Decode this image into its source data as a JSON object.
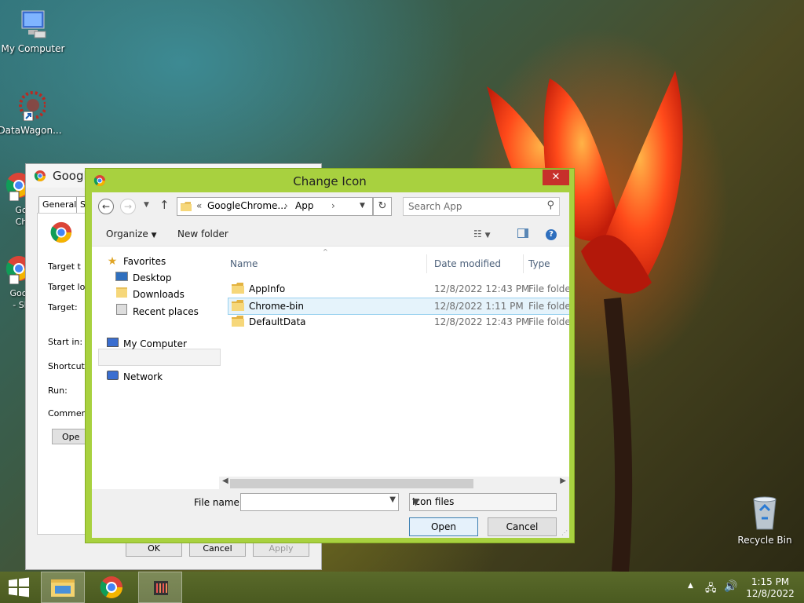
{
  "desktop": {
    "icons": [
      {
        "label": "My Computer"
      },
      {
        "label": "DataWagon..."
      },
      {
        "label": "Go"
      },
      {
        "label": "Ch"
      },
      {
        "label": "Goog"
      },
      {
        "label": "- Sh"
      },
      {
        "label": "Recycle Bin"
      }
    ]
  },
  "properties_window": {
    "title": "Googl",
    "tabs": [
      "General",
      "S"
    ],
    "labels": [
      "Target t",
      "Target lo",
      "Target:",
      "Start in:",
      "Shortcut",
      "Run:",
      "Commen"
    ],
    "open_button": "Ope",
    "buttons": {
      "ok": "OK",
      "cancel": "Cancel",
      "apply": "Apply"
    }
  },
  "dialog": {
    "title": "Change Icon",
    "close_glyph": "✕",
    "address": {
      "prefix": "«",
      "segment1": "GoogleChrome...",
      "sep": "›",
      "segment2": "App",
      "sep2": "›"
    },
    "search_placeholder": "Search App",
    "toolbar": {
      "organize": "Organize",
      "new_folder": "New folder"
    },
    "nav": {
      "favorites": "Favorites",
      "desktop": "Desktop",
      "downloads": "Downloads",
      "recent": "Recent places",
      "my_computer": "My Computer",
      "network": "Network"
    },
    "columns": {
      "name": "Name",
      "date": "Date modified",
      "type": "Type"
    },
    "files": [
      {
        "name": "AppInfo",
        "date": "12/8/2022 12:43 PM",
        "type": "File folder"
      },
      {
        "name": "Chrome-bin",
        "date": "12/8/2022 1:11 PM",
        "type": "File folder"
      },
      {
        "name": "DefaultData",
        "date": "12/8/2022 12:43 PM",
        "type": "File folder"
      }
    ],
    "file_name_label": "File name:",
    "file_name_value": "",
    "file_type": "Icon files",
    "open_button": "Open",
    "cancel_button": "Cancel"
  },
  "taskbar": {
    "time": "1:15 PM",
    "date": "12/8/2022"
  },
  "colors": {
    "dialog_frame": "#a8d13f",
    "close_button": "#c7302b",
    "selection": "#e5f3fb",
    "taskbar": "#5a6a2a"
  }
}
